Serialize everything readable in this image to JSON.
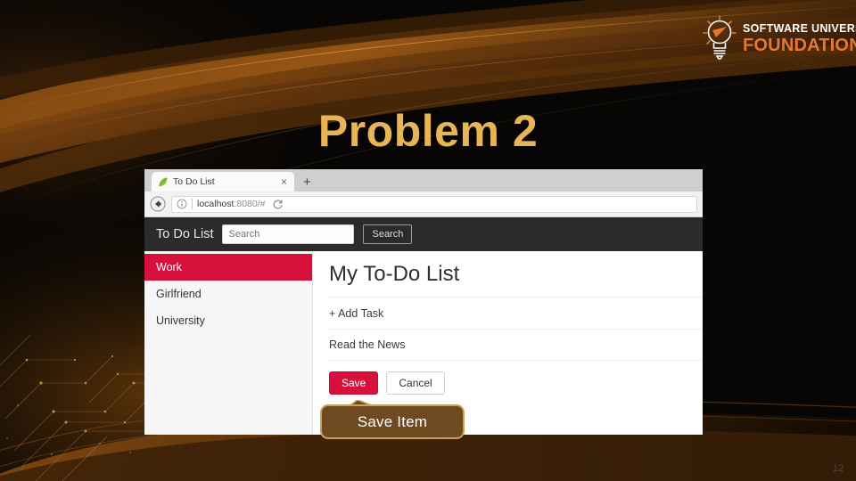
{
  "slide": {
    "title": "Problem 2",
    "page_number": "12",
    "background_color": "#080604",
    "title_color": "#E8B556"
  },
  "logo": {
    "icon": "lightbulb-icon",
    "line1": "SOFTWARE UNIVERSITY",
    "line2": "FOUNDATION",
    "line1_color": "#FFFFFF",
    "line2_color": "#E8772E"
  },
  "browser": {
    "tab": {
      "favicon": "green-leaf-icon",
      "title": "To Do List",
      "close_label": "×"
    },
    "new_tab_label": "+",
    "back_icon": "back-arrow-icon",
    "info_icon": "info-circle-icon",
    "url_host": "localhost",
    "url_rest": ":8080/#",
    "reload_icon": "reload-icon"
  },
  "app": {
    "brand": "To Do List",
    "search": {
      "placeholder": "Search",
      "value": "",
      "button_label": "Search"
    },
    "sidebar": {
      "items": [
        {
          "label": "Work",
          "active": true
        },
        {
          "label": "Girlfriend",
          "active": false
        },
        {
          "label": "University",
          "active": false
        }
      ],
      "active_color": "#D6123C"
    },
    "content": {
      "heading": "My To-Do List",
      "add_task_label": "+ Add Task",
      "tasks": [
        {
          "label": "Read the News"
        }
      ],
      "save_label": "Save",
      "cancel_label": "Cancel",
      "save_color": "#D6123C"
    }
  },
  "callout": {
    "text": "Save Item",
    "fill_color": "#6F4A20",
    "border_color": "#C9A15C",
    "text_color": "#FFFFFF"
  }
}
